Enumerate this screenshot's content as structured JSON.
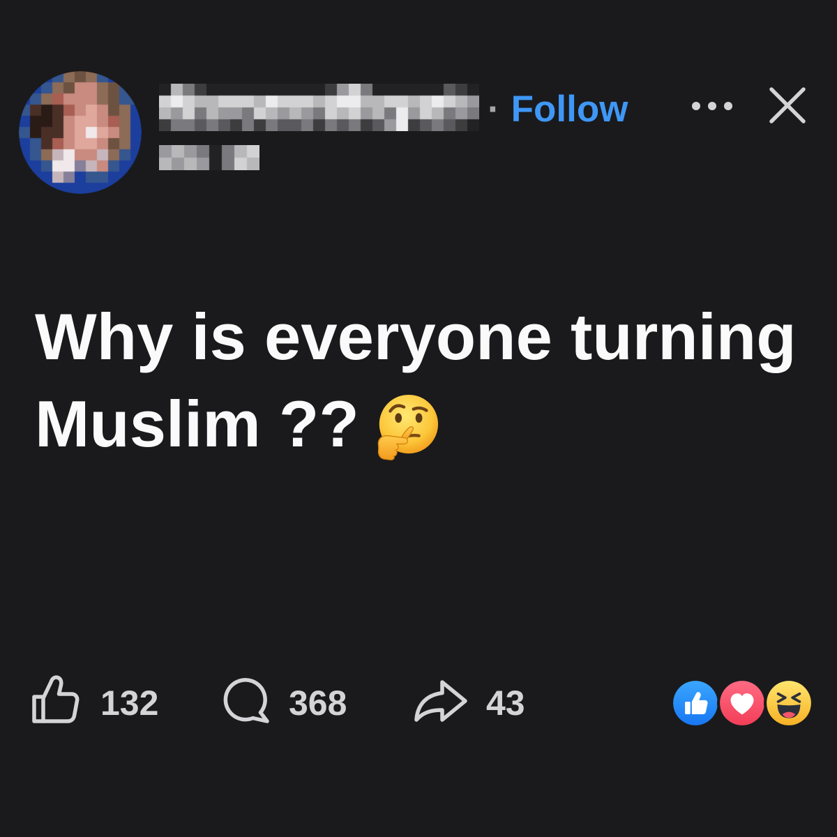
{
  "theme": {
    "background": "#1a1a1c",
    "text": "#fafafa",
    "accent": "#3f97f6",
    "muted": "#d4d4d8",
    "separator": "#a5a5aa"
  },
  "header": {
    "avatar_icon": "pixelated-avatar",
    "separator": "·",
    "follow_label": "Follow",
    "more_icon": "more-dots-icon",
    "close_icon": "close-icon"
  },
  "post": {
    "text_lines": [
      "Why is everyone turning",
      "Muslim ??"
    ],
    "emoji_icon": "thinking-face-emoji"
  },
  "actions": {
    "like": {
      "icon": "thumbs-up-icon",
      "count": 132
    },
    "comment": {
      "icon": "comment-bubble-icon",
      "count": 368
    },
    "share": {
      "icon": "share-arrow-icon",
      "count": 43
    }
  },
  "reactions": [
    {
      "icon": "like-reaction-icon",
      "color": "#1877f2"
    },
    {
      "icon": "love-reaction-icon",
      "color": "#f33e58"
    },
    {
      "icon": "haha-reaction-icon",
      "color": "#f7b125"
    }
  ]
}
